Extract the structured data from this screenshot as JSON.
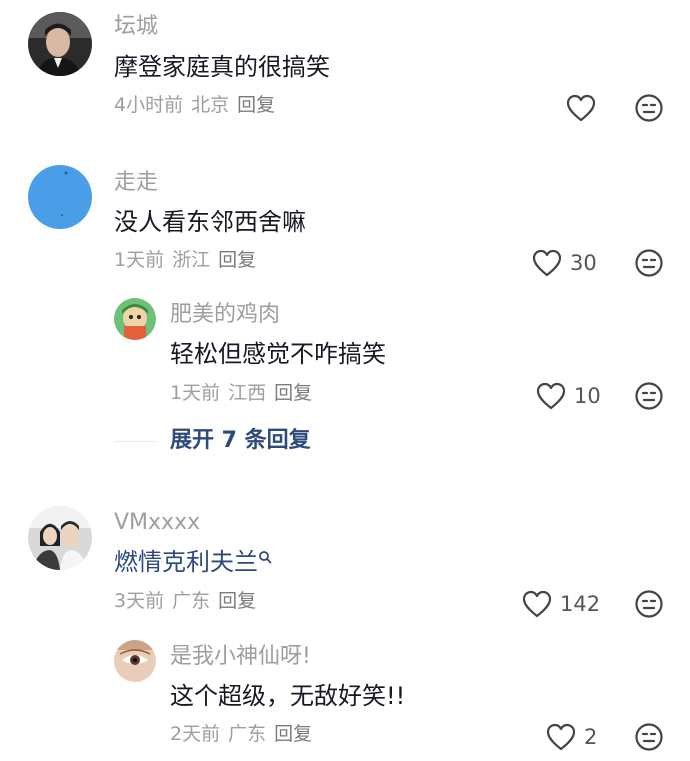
{
  "comments": [
    {
      "name": "坛城",
      "text": "摩登家庭真的很搞笑",
      "time": "4小时前",
      "location": "北京",
      "reply_label": "回复",
      "likes": ""
    },
    {
      "name": "走走",
      "text": "没人看东邻西舍嘛",
      "time": "1天前",
      "location": "浙江",
      "reply_label": "回复",
      "likes": "30",
      "replies": [
        {
          "name": "肥美的鸡肉",
          "text": "轻松但感觉不咋搞笑",
          "time": "1天前",
          "location": "江西",
          "reply_label": "回复",
          "likes": "10"
        }
      ],
      "expand_label": "展开 7 条回复"
    },
    {
      "name": "VMxxxx",
      "text": "燃情克利夫兰",
      "time": "3天前",
      "location": "广东",
      "reply_label": "回复",
      "likes": "142",
      "replies": [
        {
          "name": "是我小神仙呀!",
          "text": "这个超级，无敌好笑!!",
          "time": "2天前",
          "location": "广东",
          "reply_label": "回复",
          "likes": "2"
        }
      ]
    }
  ],
  "colors": {
    "text": "#161823",
    "muted": "#9e9e9e",
    "link": "#2e4a7d"
  },
  "icons": [
    "heart-icon",
    "dislike-face-icon",
    "search-icon"
  ]
}
